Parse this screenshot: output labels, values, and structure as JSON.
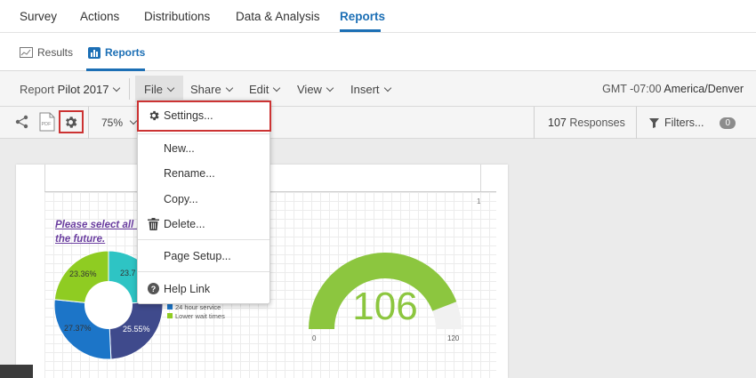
{
  "topnav": {
    "tabs": [
      {
        "label": "Survey"
      },
      {
        "label": "Actions"
      },
      {
        "label": "Distributions"
      },
      {
        "label": "Data & Analysis"
      },
      {
        "label": "Reports",
        "active": true
      }
    ]
  },
  "subnav": {
    "results_label": "Results",
    "reports_label": "Reports"
  },
  "toolbar": {
    "report_prefix": "Report",
    "report_name": "Pilot 2017",
    "menus": [
      "File",
      "Share",
      "Edit",
      "View",
      "Insert"
    ],
    "timezone_prefix": "GMT -07:00",
    "timezone_name": "America/Denver"
  },
  "toolbar2": {
    "zoom": "75%",
    "pdf_label": "PDF",
    "responses_count": "107",
    "responses_label": "Responses",
    "filters_label": "Filters...",
    "filters_count": "0"
  },
  "file_menu": {
    "items": [
      "Settings...",
      "New...",
      "Rename...",
      "Copy...",
      "Delete...",
      "Page Setup...",
      "Help Link"
    ]
  },
  "report_page": {
    "question_text": "Please select all f... the future.",
    "question_line1": "Please select all f",
    "question_line2": "the future.",
    "page_number": "1",
    "donut": {
      "labels": [
        "23.36%",
        "23.7",
        "25.55%",
        "27.37%"
      ],
      "colors": [
        "#2ec4c4",
        "#3f4a8c",
        "#1c75c8",
        "#8fcc22"
      ]
    },
    "legend": [
      {
        "label": "24 hour service",
        "color": "#1c75c8"
      },
      {
        "label": "Lower wait times",
        "color": "#8fcc22"
      }
    ],
    "gauge": {
      "value": "106",
      "min": "0",
      "max": "120",
      "fill_color": "#8cc63f"
    }
  },
  "colors": {
    "accent": "#1c6fb5",
    "highlight": "#cc3333"
  }
}
